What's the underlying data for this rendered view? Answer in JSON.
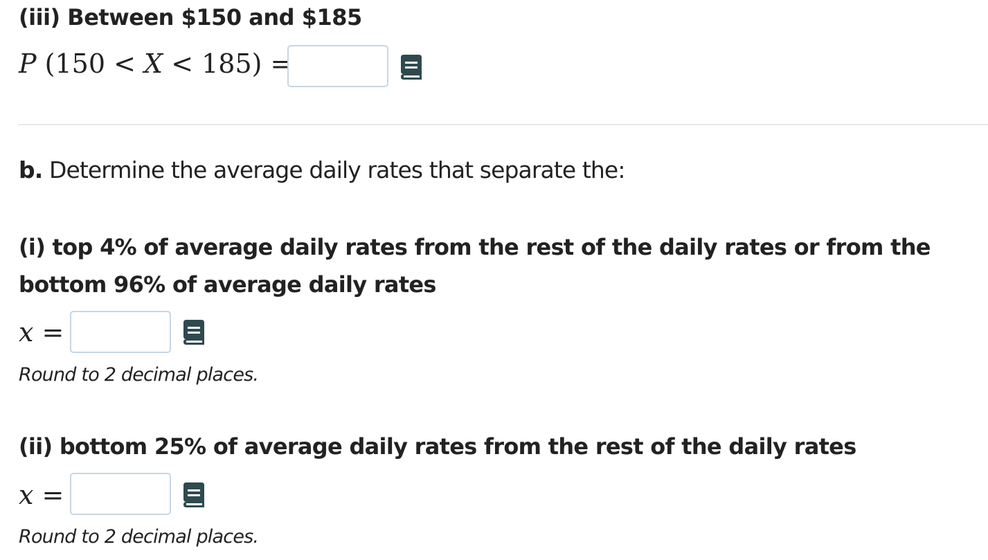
{
  "part_a_iii": {
    "heading": "(iii) Between $150 and $185",
    "equation_prefix": "P",
    "equation_open": "(150 <",
    "equation_var": "X",
    "equation_close": "< 185) =",
    "answer_value": ""
  },
  "part_b": {
    "label": "b.",
    "prompt": "Determine the average daily rates that separate the:",
    "sub_i": {
      "line1": "(i) top 4% of average daily rates from the rest of the daily rates or from the",
      "line2": "bottom 96% of average daily rates",
      "var": "x",
      "equals": "=",
      "answer_value": "",
      "hint": "Round to 2 decimal places."
    },
    "sub_ii": {
      "text": "(ii) bottom 25% of average daily rates from the rest of the daily rates",
      "var": "x",
      "equals": "=",
      "answer_value": "",
      "hint": "Round to 2 decimal places."
    }
  },
  "icons": {
    "reference": "book-icon",
    "icon_color": "#2e4a4f"
  }
}
